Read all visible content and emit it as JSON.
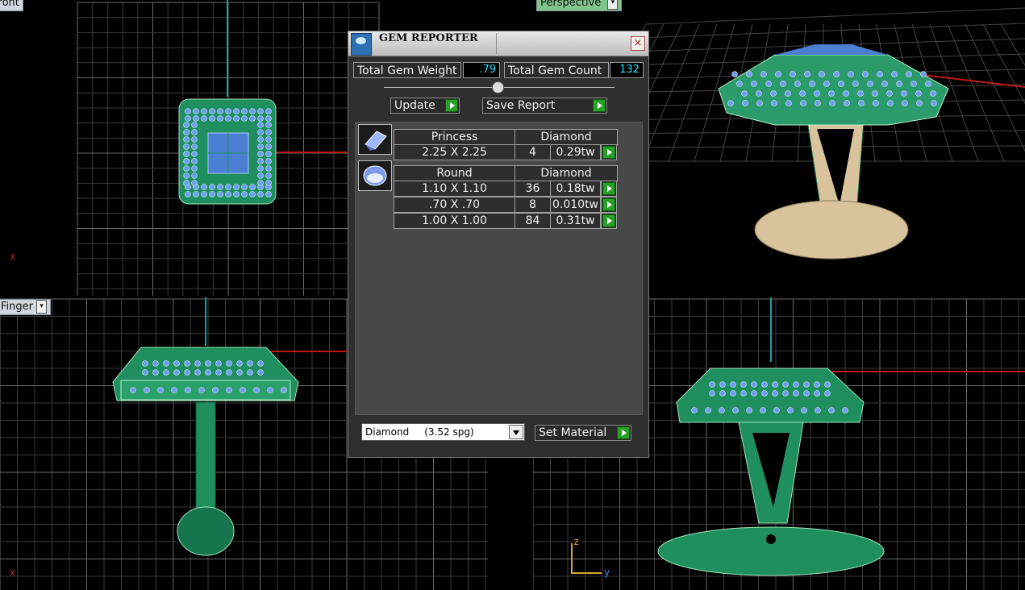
{
  "viewports": {
    "top_left": {
      "tab_label": "Front",
      "axis": "x"
    },
    "top_right": {
      "tab_label": "Perspective"
    },
    "bottom_left": {
      "tab_label": "Finger",
      "axis": "x"
    },
    "bottom_right": {
      "axis_z": "z",
      "axis_y": "y"
    }
  },
  "dialog": {
    "title": "GEM REPORTER",
    "close_glyph": "×",
    "total_weight_label": "Total Gem Weight",
    "total_weight_value": ".79",
    "total_count_label": "Total Gem Count",
    "total_count_value": "132",
    "update_label": "Update",
    "save_report_label": "Save Report",
    "groups": [
      {
        "icon": "princess-cut-gem-icon",
        "shape": "Princess",
        "material": "Diamond",
        "rows": [
          {
            "size": "2.25 X 2.25",
            "count": "4",
            "weight": "0.29tw"
          }
        ]
      },
      {
        "icon": "round-cut-gem-icon",
        "shape": "Round",
        "material": "Diamond",
        "rows": [
          {
            "size": "1.10 X 1.10",
            "count": "36",
            "weight": "0.18tw"
          },
          {
            "size": ".70 X .70",
            "count": "8",
            "weight": "0.010tw"
          },
          {
            "size": "1.00 X 1.00",
            "count": "84",
            "weight": "0.31tw"
          }
        ]
      }
    ],
    "material_select_value": "Diamond     (3.52 spg)",
    "set_material_label": "Set Material"
  },
  "colors": {
    "model_green": "#1f8f5f",
    "gem_blue": "#6f9ef0",
    "cream": "#d8c39c",
    "grid": "#555555",
    "accent_cyan": "#22e0ff",
    "play_green": "#27a127"
  }
}
